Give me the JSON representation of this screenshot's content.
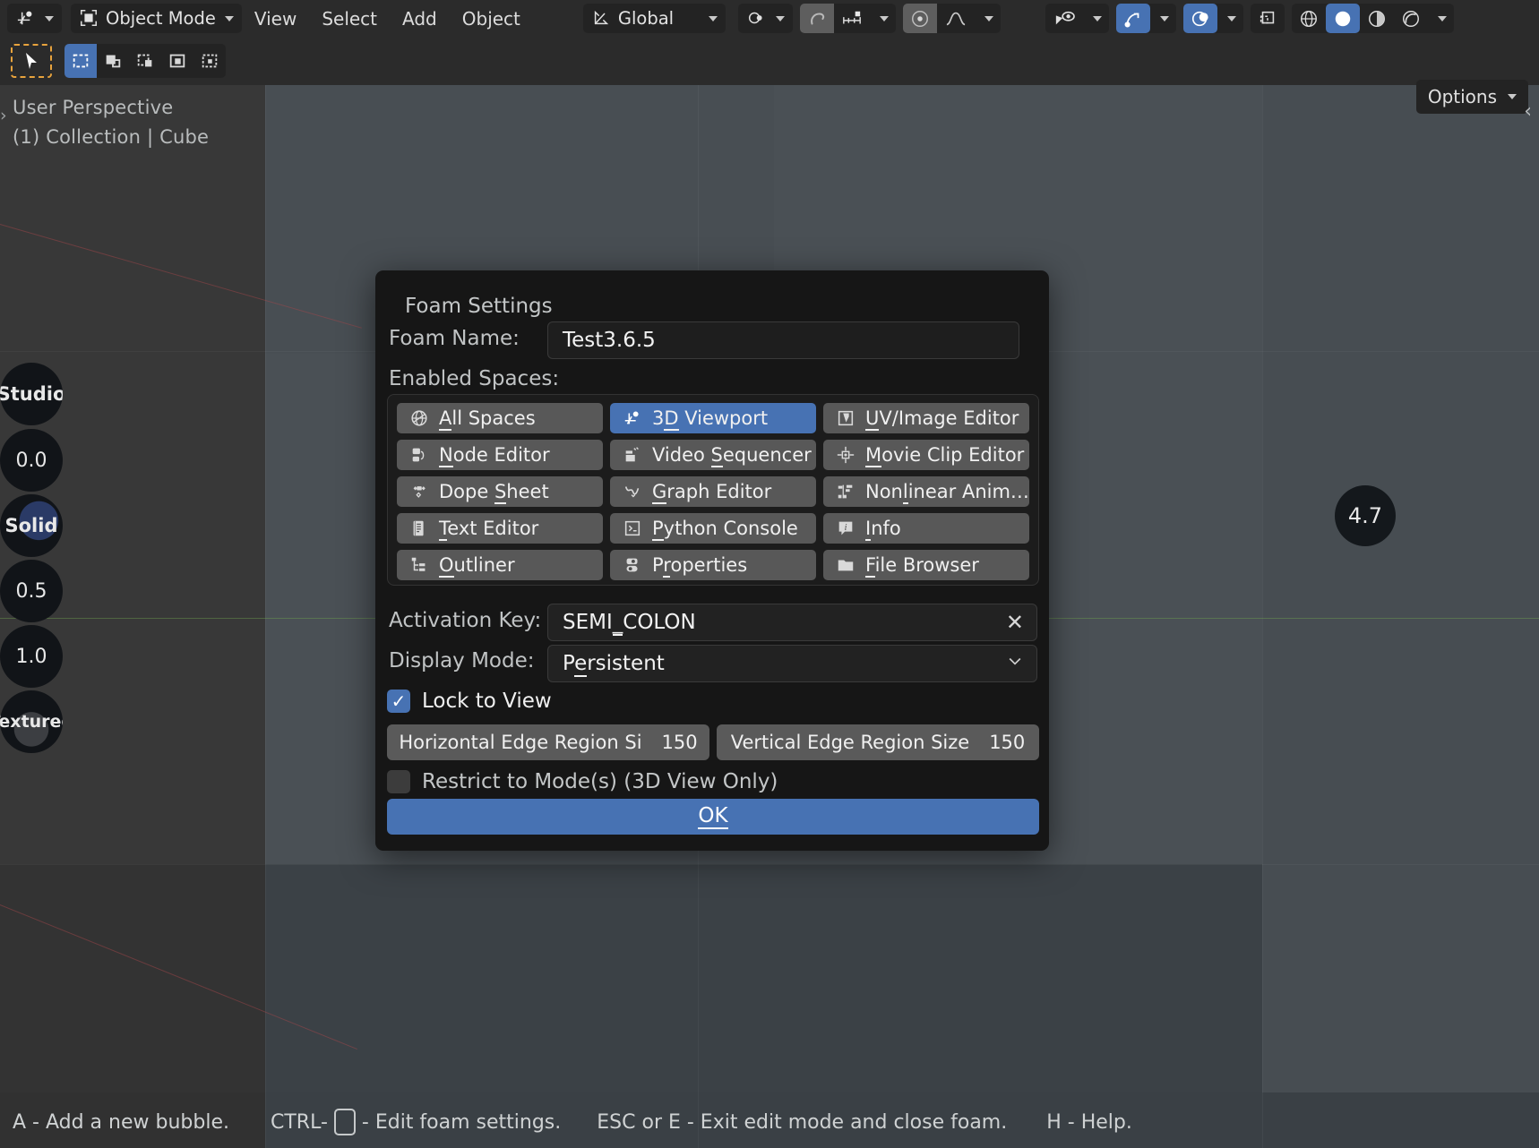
{
  "app": {
    "mode_label": "Object Mode",
    "menus": [
      "View",
      "Select",
      "Add",
      "Object"
    ],
    "transform_orientation": "Global",
    "options_label": "Options"
  },
  "viewport": {
    "perspective_label": "User Perspective",
    "collection_label": "(1) Collection | Cube",
    "nav_value": "4.7",
    "gizmo_pills": [
      {
        "label": "Studio"
      },
      {
        "label": "0.0"
      },
      {
        "label": "Solid"
      },
      {
        "label": "0.5"
      },
      {
        "label": "1.0"
      },
      {
        "label": "Textured"
      }
    ]
  },
  "dialog": {
    "title": "Foam Settings",
    "foam_name_label": "Foam Name:",
    "foam_name_value": "Test3.6.5",
    "enabled_spaces_label": "Enabled Spaces:",
    "spaces": [
      {
        "label": "All Spaces",
        "accel": "A",
        "icon": "globe-icon",
        "active": false
      },
      {
        "label": "3D Viewport",
        "accel": "D",
        "icon": "viewport-icon",
        "active": true
      },
      {
        "label": "UV/Image Editor",
        "accel": "U",
        "icon": "uv-image-icon",
        "active": false
      },
      {
        "label": "Node Editor",
        "accel": "N",
        "icon": "node-icon",
        "active": false
      },
      {
        "label": "Video Sequencer",
        "accel": "S",
        "icon": "sequencer-icon",
        "active": false
      },
      {
        "label": "Movie Clip Editor",
        "accel": "M",
        "icon": "movieclip-icon",
        "active": false
      },
      {
        "label": "Dope Sheet",
        "accel": "S",
        "icon": "dopesheet-icon",
        "active": false
      },
      {
        "label": "Graph Editor",
        "accel": "G",
        "icon": "graph-icon",
        "active": false
      },
      {
        "label": "Nonlinear Anim…",
        "accel": "l",
        "icon": "nla-icon",
        "active": false
      },
      {
        "label": "Text Editor",
        "accel": "T",
        "icon": "text-icon",
        "active": false
      },
      {
        "label": "Python Console",
        "accel": "P",
        "icon": "console-icon",
        "active": false
      },
      {
        "label": "Info",
        "accel": "I",
        "icon": "info-icon",
        "active": false
      },
      {
        "label": "Outliner",
        "accel": "O",
        "icon": "outliner-icon",
        "active": false
      },
      {
        "label": "Properties",
        "accel": "r",
        "icon": "properties-icon",
        "active": false
      },
      {
        "label": "File Browser",
        "accel": "F",
        "icon": "filebrowser-icon",
        "active": false
      }
    ],
    "activation_key_label": "Activation Key:",
    "activation_key_value": "SEMI_COLON",
    "display_mode_label": "Display Mode:",
    "display_mode_value": "Persistent",
    "lock_to_view_label": "Lock to View",
    "lock_to_view_checked": true,
    "horizontal_edge_label": "Horizontal Edge Region Si",
    "horizontal_edge_value": "150",
    "vertical_edge_label": "Vertical Edge Region Size",
    "vertical_edge_value": "150",
    "restrict_label": "Restrict to Mode(s) (3D View Only)",
    "restrict_checked": false,
    "ok_label": "OK",
    "accent_color": "#4772b3"
  },
  "status": {
    "item1": "A - Add a new bubble.",
    "item2a": "CTRL-",
    "item2b": "- Edit foam settings.",
    "item3": "ESC or E - Exit edit mode and close foam.",
    "item4": "H - Help."
  }
}
